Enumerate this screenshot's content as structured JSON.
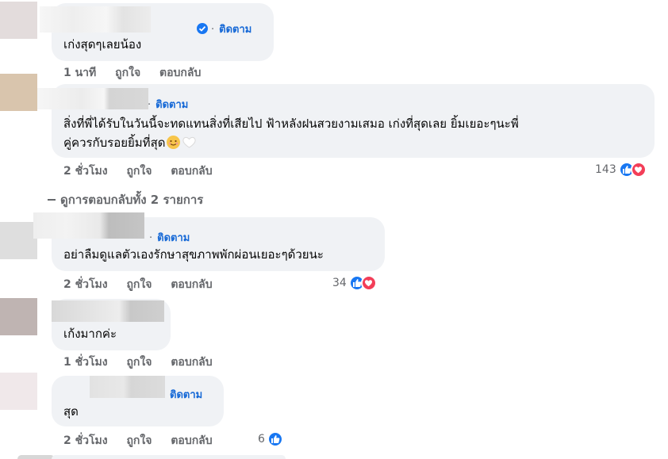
{
  "labels": {
    "follow": "ติดตาม",
    "like": "ถูกใจ",
    "reply": "ตอบกลับ"
  },
  "comments": [
    {
      "text": "เก่งสุดๆเลยน้อง",
      "time": "1 นาที"
    },
    {
      "text_line1": "สิ่งที่พี่ได้รับในวันนี้จะทดแทนสิ่งที่เสียไป ฟ้าหลังฝนสวยงามเสมอ เก่งที่สุดเลย ยิ้มเยอะๆนะพี่",
      "text_line2": "คู่ควรกับรอยยิ้มที่สุด",
      "time": "2 ชั่วโมง",
      "reaction_count": "143"
    },
    {
      "text": "อย่าลืมดูแลตัวเองรักษาสุขภาพพักผ่อนเยอะๆด้วยนะ",
      "time": "2 ชั่วโมง",
      "reaction_count": "34"
    },
    {
      "text": "เก้งมากค่ะ",
      "time": "1 ชั่วโมง"
    },
    {
      "text": "สุด",
      "time": "2 ชั่วโมง",
      "reaction_count": "6"
    }
  ],
  "view_replies": "ดูการตอบกลับทั้ง 2 รายการ",
  "colors": {
    "accent": "#1568d6",
    "like": "#1877f2",
    "love": "#f33e58",
    "bubble": "#f0f2f5",
    "meta": "#65676b"
  },
  "icons": [
    "verified-badge-icon",
    "smiling-face-emoji-icon",
    "white-heart-emoji-icon",
    "like-reaction-icon",
    "love-reaction-icon",
    "reply-arrow-icon"
  ]
}
